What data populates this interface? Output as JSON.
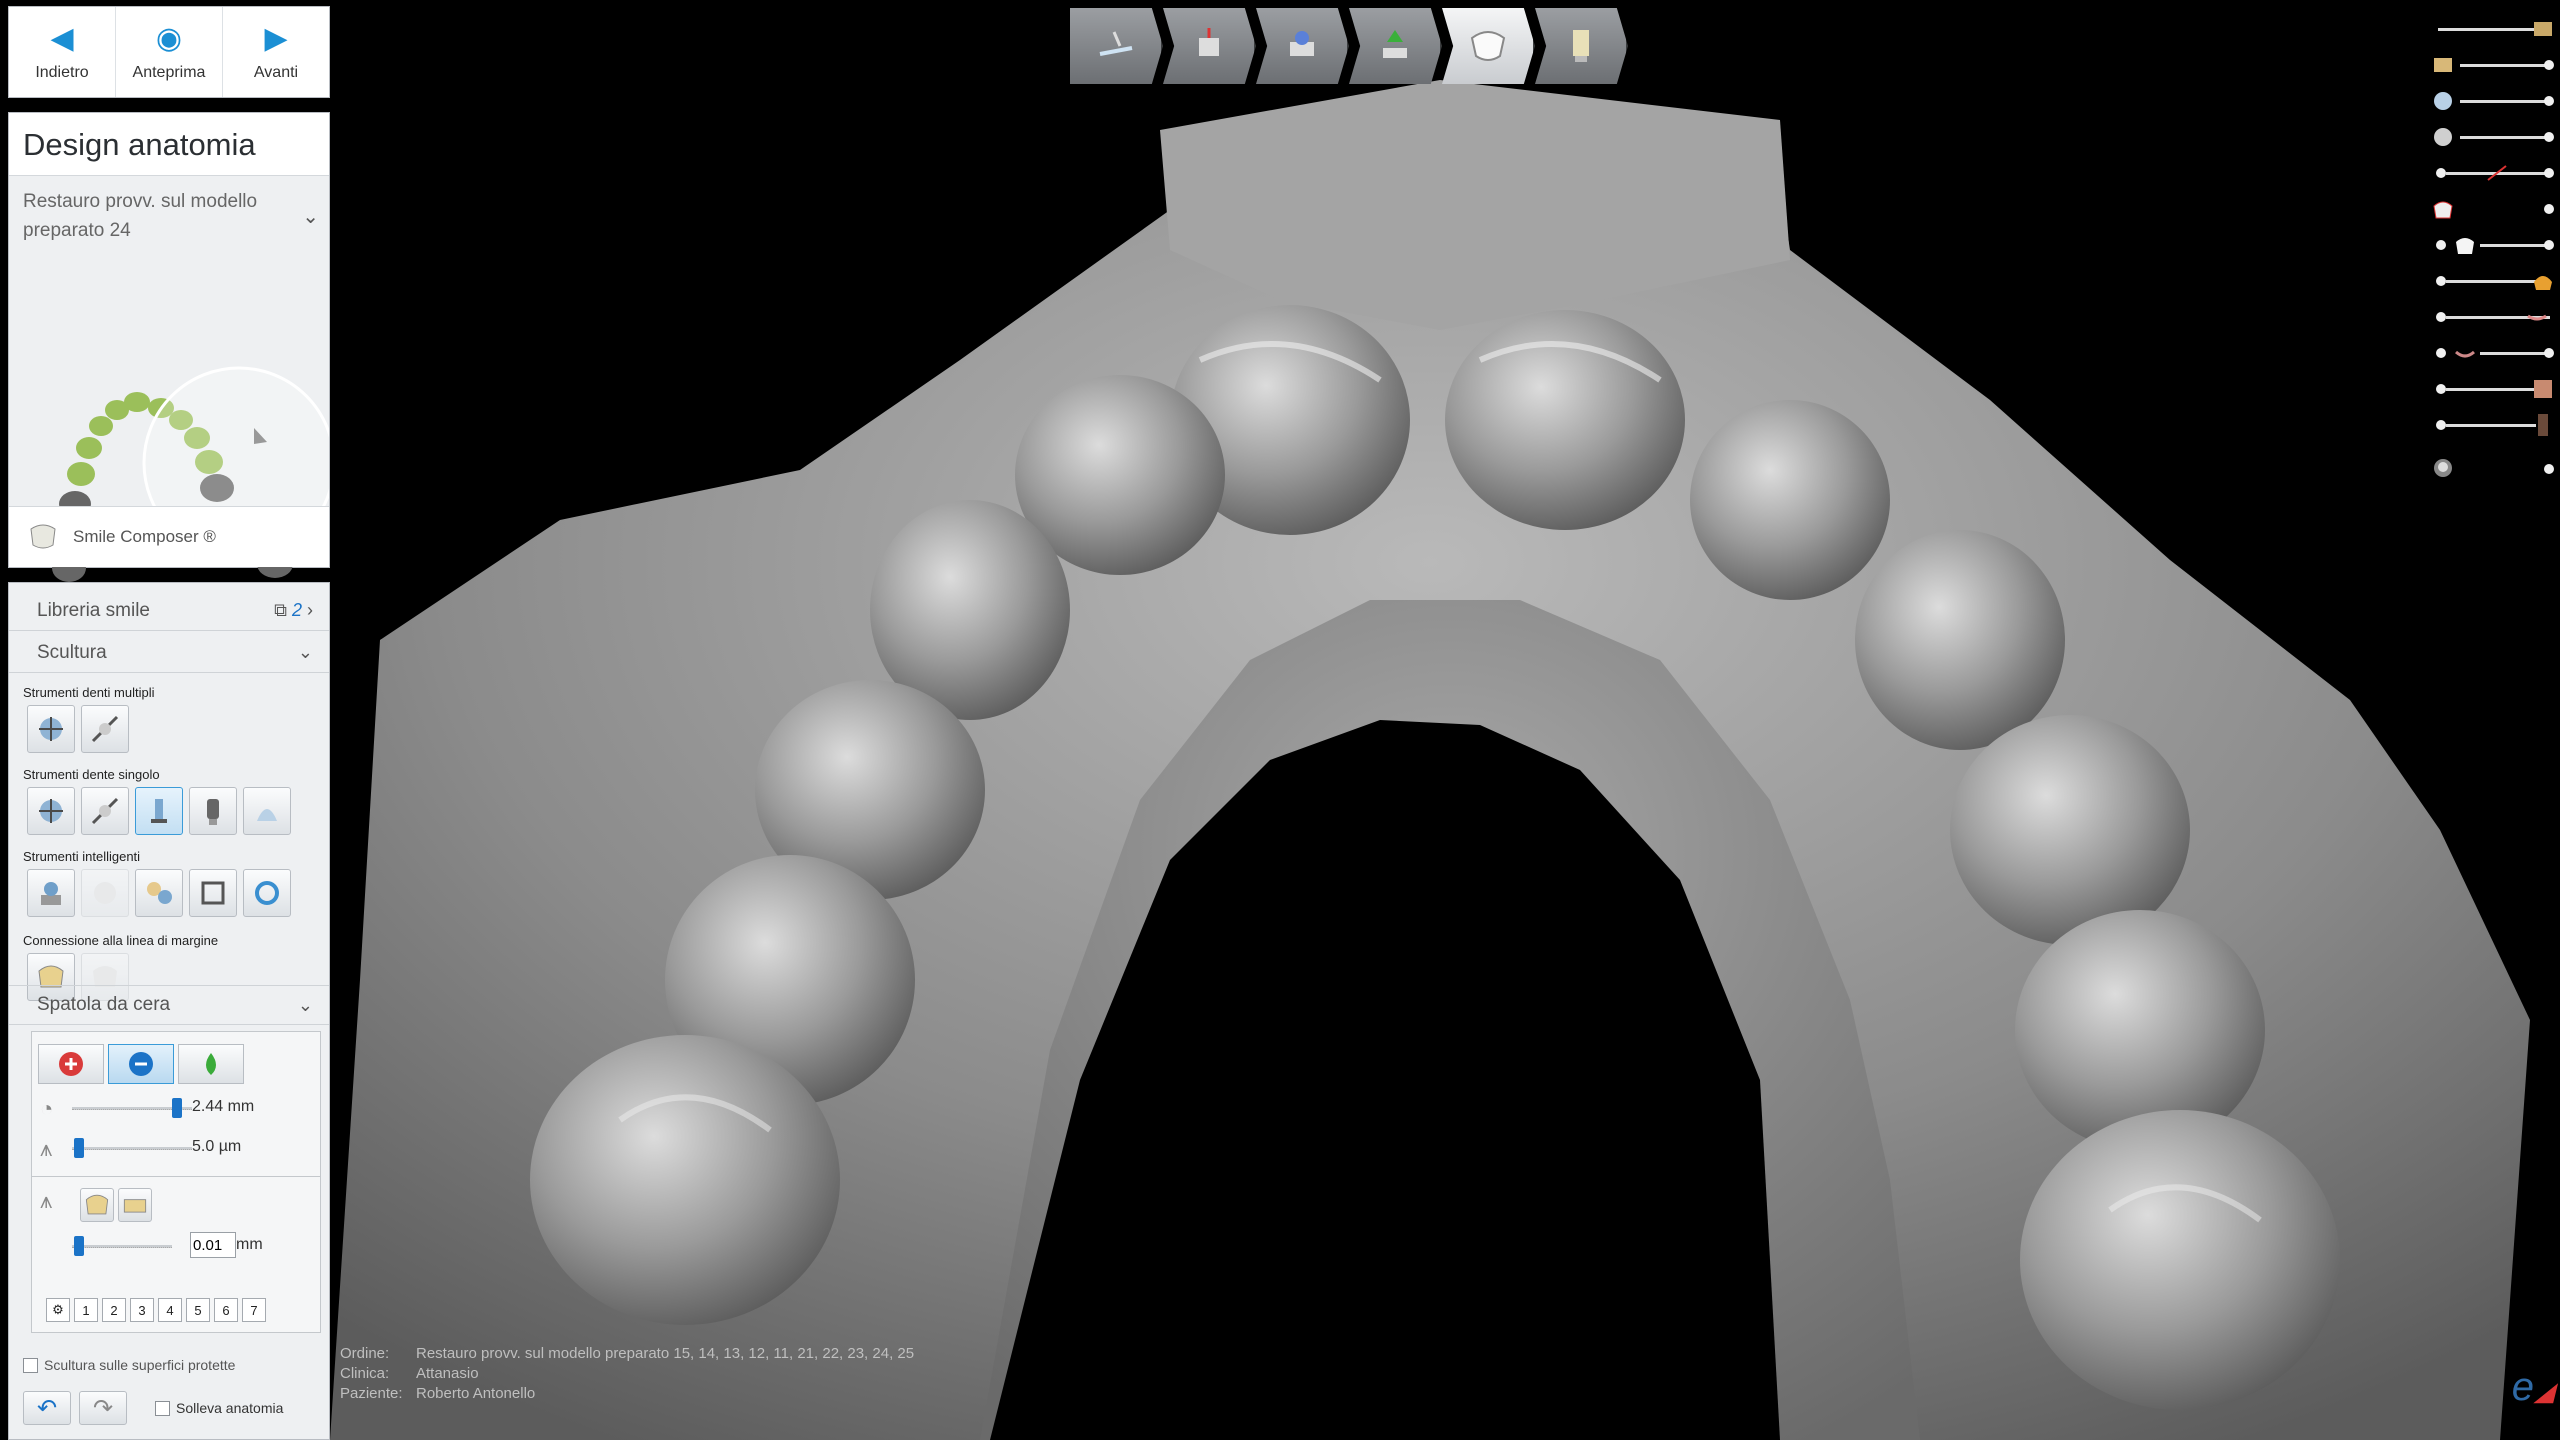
{
  "nav": {
    "back_label": "Indietro",
    "preview_label": "Anteprima",
    "forward_label": "Avanti"
  },
  "design": {
    "title": "Design anatomia",
    "restoration_line1": "Restauro provv. sul modello",
    "restoration_line2": "preparato 24",
    "smile_composer_label": "Smile Composer ®"
  },
  "tools": {
    "library_label": "Libreria smile",
    "library_page": "2",
    "sculpt_label": "Scultura",
    "multi_tooth_label": "Strumenti denti multipli",
    "single_tooth_label": "Strumenti dente singolo",
    "smart_label": "Strumenti intelligenti",
    "margin_label": "Connessione alla linea di margine",
    "wax_knife_label": "Spatola da cera",
    "radius_value": "2.44 mm",
    "strength_value": "5.0 µm",
    "offset_value": "0.01",
    "offset_unit": "mm",
    "numbers": [
      "1",
      "2",
      "3",
      "4",
      "5",
      "6",
      "7"
    ],
    "protected_label": "Scultura sulle superfici protette",
    "raise_anatomy_label": "Solleva anatomia"
  },
  "order": {
    "order_key": "Ordine:",
    "order_value": "Restauro provv. sul modello preparato 15, 14, 13, 12, 11, 21, 22, 23, 24, 25",
    "clinic_key": "Clinica:",
    "clinic_value": "Attanasio",
    "patient_key": "Paziente:",
    "patient_value": "Roberto Antonello"
  },
  "brand": {
    "mark": "e"
  },
  "colors": {
    "accent_blue": "#1b8fd4",
    "panel_bg": "#eef0f2",
    "model_gray": "#8f8f8f",
    "tooth_green": "#9bbf5a"
  },
  "icons": {
    "workflow": [
      "margin-line-icon",
      "insertion-axis-icon",
      "cement-gap-icon",
      "abutment-icon",
      "anatomy-icon",
      "crown-bottom-icon"
    ],
    "visibility": [
      "antagonist-icon",
      "abutment-scan-icon",
      "model-icon",
      "gingiva-icon",
      "anatomy-icon",
      "restoration-icon",
      "color-icon",
      "lip-icon",
      "face-icon",
      "photo-icon",
      "head-icon"
    ]
  }
}
